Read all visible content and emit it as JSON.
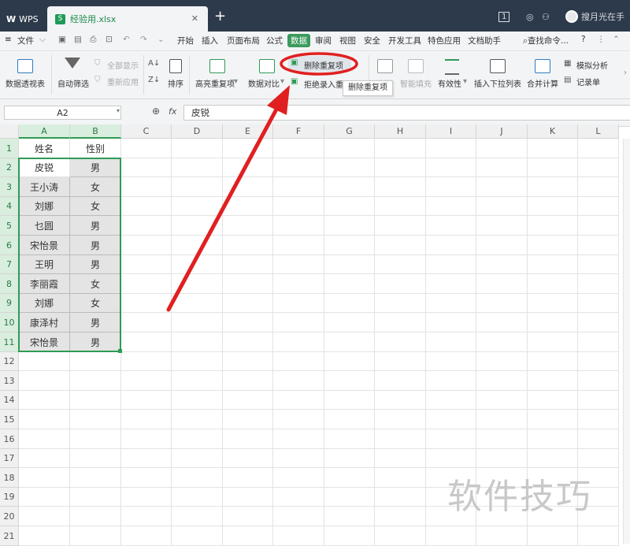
{
  "titlebar": {
    "app_tab": "WPS",
    "file_tab": "经验用.xlsx",
    "file_icon_letter": "S",
    "page_indicator": "1",
    "user_name": "搜月光在手"
  },
  "menubar": {
    "file_label": "文件",
    "tabs": [
      "开始",
      "插入",
      "页面布局",
      "公式",
      "数据",
      "审阅",
      "视图",
      "安全",
      "开发工具",
      "特色应用",
      "文档助手"
    ],
    "active_tab": "数据",
    "search_label": "查找命令..."
  },
  "ribbon": {
    "pivot": "数据透视表",
    "autofilter": "自动筛选",
    "show_all": "全部显示",
    "reapply": "重新应用",
    "sort": "排序",
    "highlight_dup": "高亮重复项",
    "compare": "数据对比",
    "delete_dup": "删除重复项",
    "reject_dup": "拒绝录入重复项",
    "split": "分列",
    "smart_fill": "智能填充",
    "validity": "有效性",
    "insert_dropdown": "插入下拉列表",
    "merge_calc": "合并计算",
    "simulate": "模拟分析",
    "record": "记录单",
    "tooltip": "删除重复项"
  },
  "formula": {
    "cell_ref": "A2",
    "fx": "fx",
    "value": "皮锐"
  },
  "sheet": {
    "columns": [
      "A",
      "B",
      "C",
      "D",
      "E",
      "F",
      "G",
      "H",
      "I",
      "J",
      "K",
      "L"
    ],
    "rows": [
      [
        "姓名",
        "性别"
      ],
      [
        "皮锐",
        "男"
      ],
      [
        "王小涛",
        "女"
      ],
      [
        "刘娜",
        "女"
      ],
      [
        "乜圆",
        "男"
      ],
      [
        "宋怡景",
        "男"
      ],
      [
        "王明",
        "男"
      ],
      [
        "李丽霞",
        "女"
      ],
      [
        "刘娜",
        "女"
      ],
      [
        "康泽村",
        "男"
      ],
      [
        "宋怡景",
        "男"
      ],
      [
        "",
        ""
      ],
      [
        "",
        ""
      ],
      [
        "",
        ""
      ],
      [
        "",
        ""
      ],
      [
        "",
        ""
      ],
      [
        "",
        ""
      ],
      [
        "",
        ""
      ],
      [
        "",
        ""
      ],
      [
        "",
        ""
      ],
      [
        "",
        ""
      ]
    ]
  },
  "annotation_color": "#e02020",
  "accent_color": "#2f9a55",
  "watermark": "软件技巧"
}
